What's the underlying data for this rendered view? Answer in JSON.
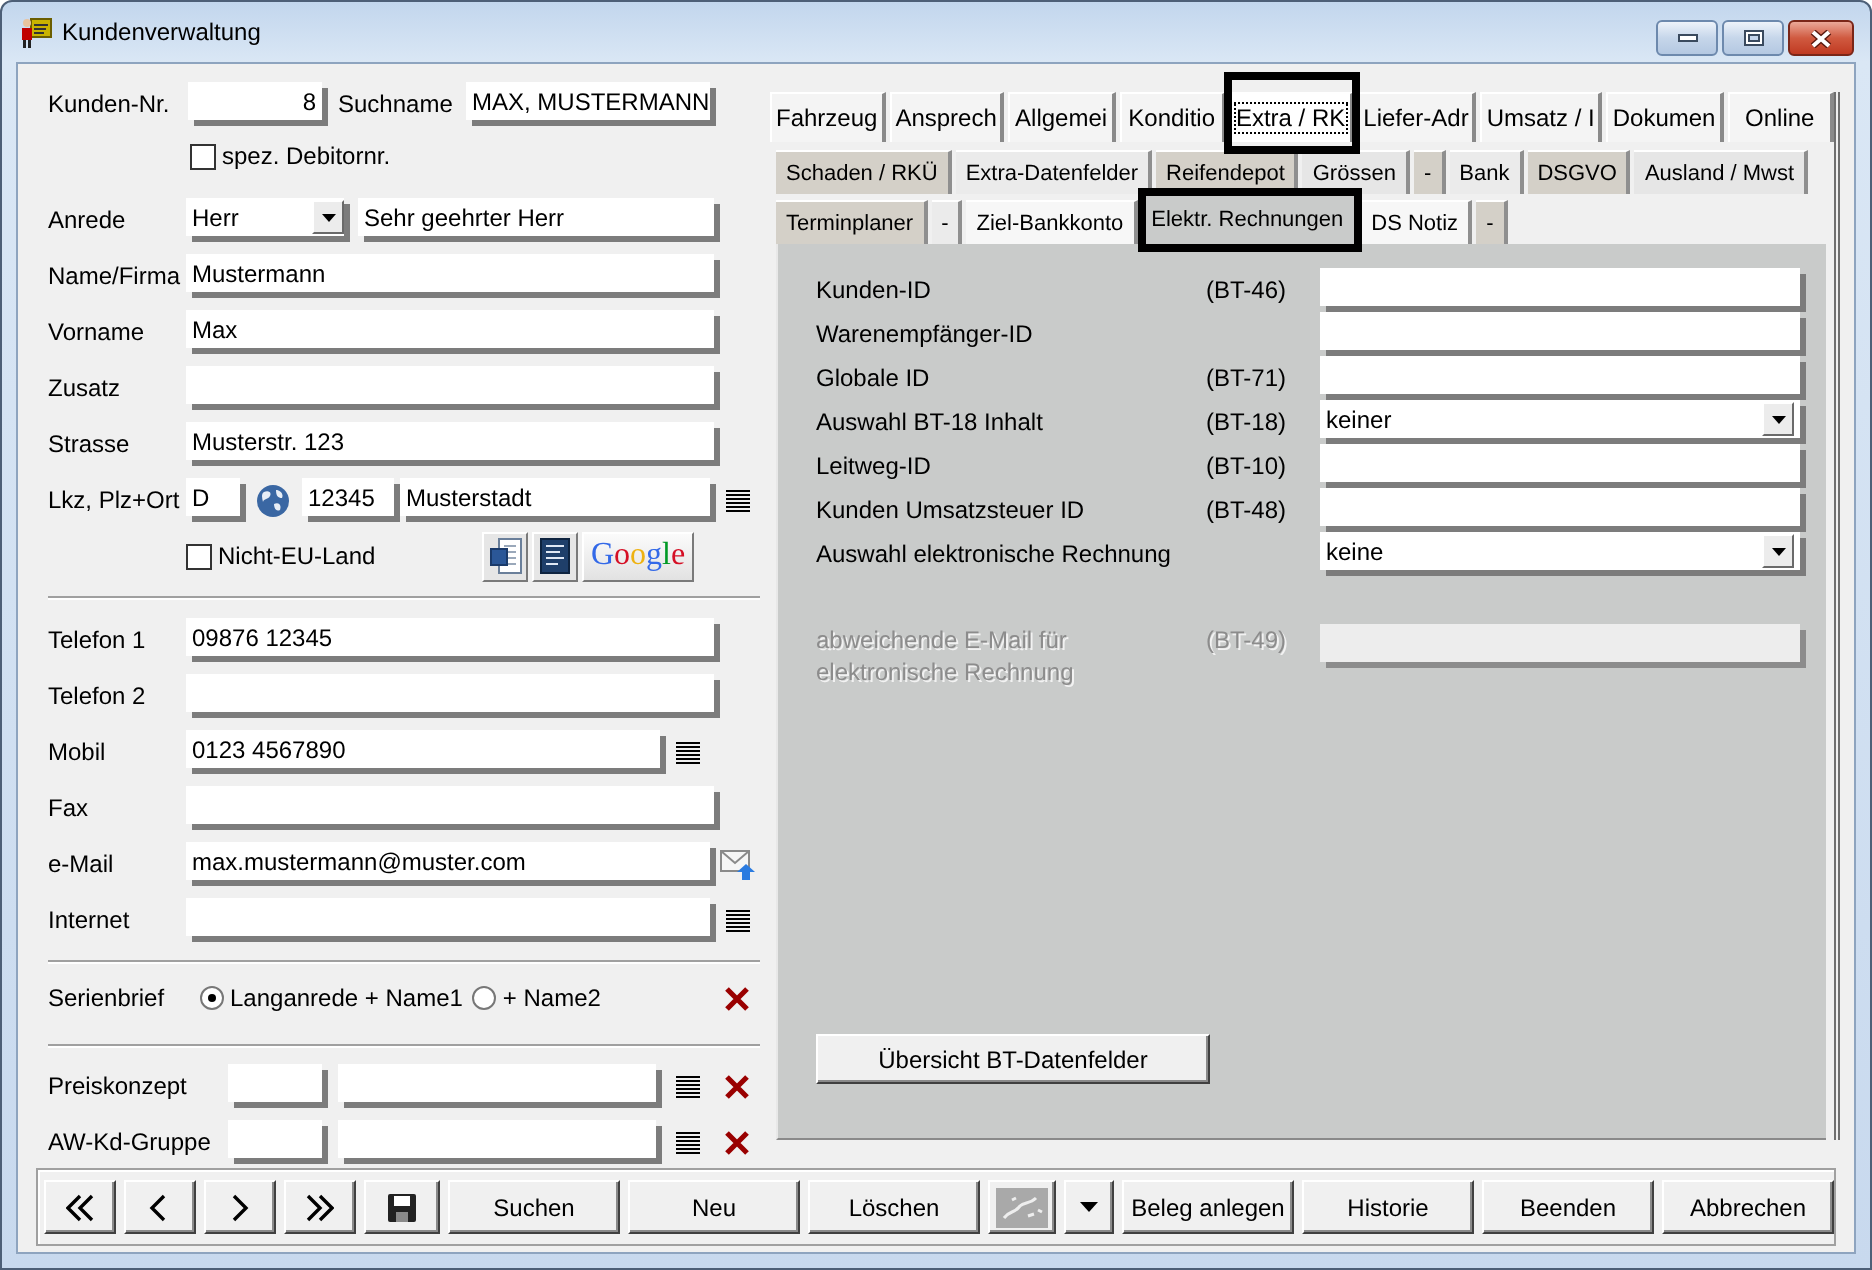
{
  "window": {
    "title": "Kundenverwaltung"
  },
  "customer": {
    "number": {
      "label": "Kunden-Nr.",
      "value": "8"
    },
    "search_name": {
      "label": "Suchname",
      "value": "MAX, MUSTERMANN"
    },
    "special_debtor": {
      "label": "spez. Debitornr.",
      "checked": false
    },
    "salutation": {
      "label": "Anrede",
      "value": "Herr",
      "letter": "Sehr geehrter Herr"
    },
    "name_rows": [
      {
        "label": "Name/Firma",
        "value": "Mustermann"
      },
      {
        "label": "Vorname",
        "value": "Max"
      },
      {
        "label": "Zusatz"
      },
      {
        "label": "Strasse",
        "value": "Musterstr. 123"
      }
    ],
    "address": {
      "label": "Lkz, Plz+Ort",
      "country": "D",
      "zip": "12345",
      "city": "Musterstadt"
    },
    "non_eu": {
      "label": "Nicht-EU-Land",
      "checked": false
    },
    "maps_button": "Google"
  },
  "contact": [
    {
      "kind": "plain",
      "label": "Telefon 1",
      "value": "09876 12345"
    },
    {
      "kind": "plain",
      "label": "Telefon 2"
    },
    {
      "kind": "list",
      "label": "Mobil",
      "value": "0123 4567890"
    },
    {
      "kind": "plain",
      "label": "Fax"
    },
    {
      "kind": "mail",
      "label": "e-Mail",
      "value": "max.mustermann@muster.com"
    },
    {
      "kind": "web",
      "label": "Internet"
    }
  ],
  "serial_letter": {
    "label": "Serienbrief",
    "options": [
      {
        "label": "Langanrede + Name1",
        "selected": true
      },
      {
        "label": "+ Name2",
        "selected": false
      }
    ]
  },
  "groups": [
    {
      "label": "Preiskonzept"
    },
    {
      "label": "AW-Kd-Gruppe"
    }
  ],
  "tabs": [
    {
      "label": "Fahrzeug",
      "selected": false,
      "highlighted": false
    },
    {
      "label": "Ansprech",
      "selected": false,
      "highlighted": false
    },
    {
      "label": "Allgemei",
      "selected": false,
      "highlighted": false
    },
    {
      "label": "Konditio",
      "selected": false,
      "highlighted": false
    },
    {
      "label": "Extra / RK",
      "selected": true,
      "highlighted": true
    },
    {
      "label": "Liefer-Adr",
      "selected": false,
      "highlighted": false
    },
    {
      "label": "Umsatz / I",
      "selected": false,
      "highlighted": false
    },
    {
      "label": "Dokumen",
      "selected": false,
      "highlighted": false
    },
    {
      "label": "Online",
      "selected": false,
      "highlighted": false
    }
  ],
  "subtab_rows": [
    {
      "tabs": [
        {
          "label": "Schaden / RKÜ",
          "color": "#d4d0c8",
          "selected": false,
          "highlighted": false
        },
        {
          "label": "Extra-Datenfelder",
          "color": "#ebebeb",
          "selected": false,
          "highlighted": false
        },
        {
          "label": "Reifendepot",
          "color": "#d4d0c8",
          "selected": false,
          "highlighted": false
        },
        {
          "label": "Grössen",
          "color": "#e6e6e6",
          "selected": false,
          "highlighted": false
        },
        {
          "label": "-",
          "color": "#d4d0c8",
          "selected": false,
          "highlighted": false
        },
        {
          "label": "Bank",
          "color": "#ebebeb",
          "selected": false,
          "highlighted": false
        },
        {
          "label": "DSGVO",
          "color": "#d4d0c8",
          "selected": false,
          "highlighted": false
        },
        {
          "label": "Ausland / Mwst",
          "color": "#e6e6e6",
          "selected": false,
          "highlighted": false
        }
      ]
    },
    {
      "tabs": [
        {
          "label": "Terminplaner",
          "color": "#d4d0c8",
          "selected": false,
          "highlighted": false
        },
        {
          "label": "-",
          "color": "#ebebeb",
          "selected": false,
          "highlighted": false
        },
        {
          "label": "Ziel-Bankkonto",
          "color": "#f7f7f7",
          "selected": false,
          "highlighted": false
        },
        {
          "label": "Elektr. Rechnungen",
          "color": "#c9cbca",
          "selected": true,
          "highlighted": true
        },
        {
          "label": "DS Notiz",
          "color": "#f7f7f7",
          "selected": false,
          "highlighted": false
        },
        {
          "label": "-",
          "color": "#d4d0c8",
          "selected": false,
          "highlighted": false
        }
      ]
    }
  ],
  "einvoice": {
    "rows": [
      {
        "kind": "text",
        "label": "Kunden-ID",
        "code": "(BT-46)"
      },
      {
        "kind": "text",
        "label": "Warenempfänger-ID"
      },
      {
        "kind": "text",
        "label": "Globale ID",
        "code": "(BT-71)"
      },
      {
        "kind": "select",
        "label": "Auswahl BT-18 Inhalt",
        "code": "(BT-18)",
        "value": "keiner"
      },
      {
        "kind": "text",
        "label": "Leitweg-ID",
        "code": "(BT-10)"
      },
      {
        "kind": "text",
        "label": "Kunden Umsatzsteuer ID",
        "code": "(BT-48)"
      },
      {
        "kind": "select",
        "label": "Auswahl elektronische Rechnung",
        "value": "keine"
      }
    ],
    "alt_email": {
      "label": "abweichende E-Mail für elektronische Rechnung",
      "code": "(BT-49)",
      "disabled": true
    },
    "overview_button": "Übersicht BT-Datenfelder"
  },
  "toolbar": [
    {
      "kind": "first"
    },
    {
      "kind": "prev"
    },
    {
      "kind": "next"
    },
    {
      "kind": "last"
    },
    {
      "kind": "save"
    },
    {
      "kind": "text",
      "label": "Suchen"
    },
    {
      "kind": "text",
      "label": "Neu"
    },
    {
      "kind": "text",
      "label": "Löschen"
    },
    {
      "kind": "picture",
      "disabled": true
    },
    {
      "kind": "dropdown"
    },
    {
      "kind": "text",
      "label": "Beleg anlegen"
    },
    {
      "kind": "text",
      "label": "Historie"
    },
    {
      "kind": "text",
      "label": "Beenden"
    },
    {
      "kind": "text",
      "label": "Abbrechen"
    }
  ]
}
